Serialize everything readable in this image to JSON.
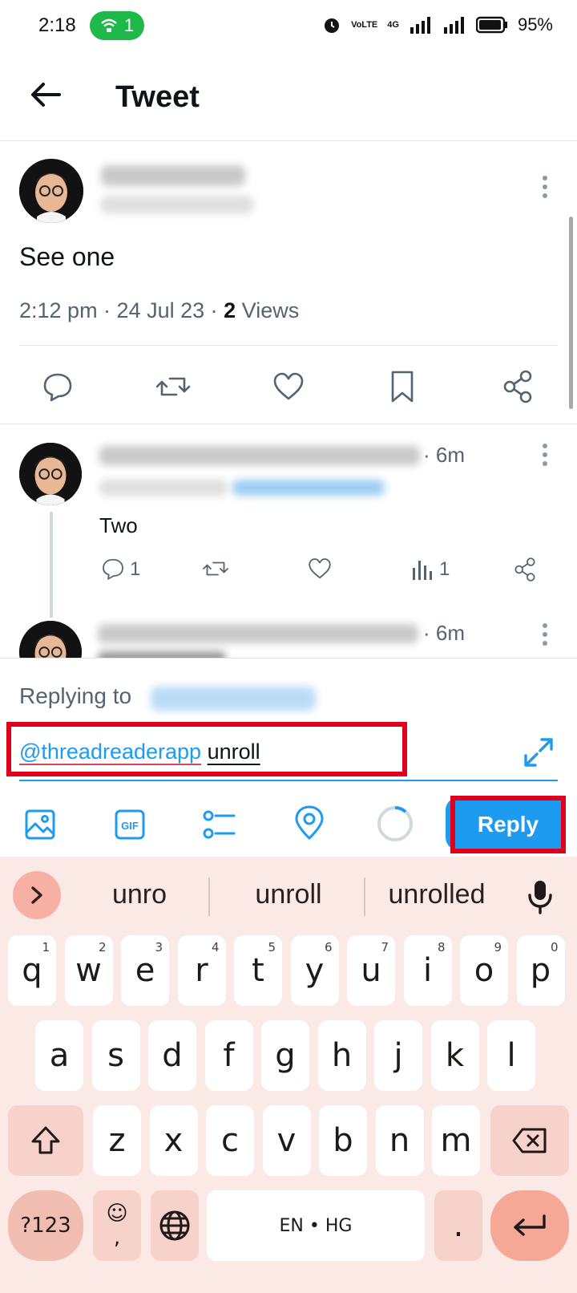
{
  "status_bar": {
    "time": "2:18",
    "hotspot_count": "1",
    "volte": "VoLTE",
    "network": "4G",
    "battery": "95%"
  },
  "header": {
    "title": "Tweet"
  },
  "main_tweet": {
    "text": "See one",
    "time": "2:12 pm · 24 Jul 23 · ",
    "views_count": "2",
    "views_label": " Views"
  },
  "replies": [
    {
      "time": "· 6m",
      "text": "Two",
      "reply_count": "1",
      "view_count": "1"
    },
    {
      "time": "· 6m"
    }
  ],
  "compose": {
    "replying_to": "Replying to",
    "mention": "@threadreaderapp",
    "text": "unroll",
    "reply_button": "Reply"
  },
  "keyboard": {
    "suggestions": [
      "unro",
      "unroll",
      "unrolled"
    ],
    "row1": [
      {
        "k": "q",
        "n": "1"
      },
      {
        "k": "w",
        "n": "2"
      },
      {
        "k": "e",
        "n": "3"
      },
      {
        "k": "r",
        "n": "4"
      },
      {
        "k": "t",
        "n": "5"
      },
      {
        "k": "y",
        "n": "6"
      },
      {
        "k": "u",
        "n": "7"
      },
      {
        "k": "i",
        "n": "8"
      },
      {
        "k": "o",
        "n": "9"
      },
      {
        "k": "p",
        "n": "0"
      }
    ],
    "row2": [
      "a",
      "s",
      "d",
      "f",
      "g",
      "h",
      "j",
      "k",
      "l"
    ],
    "row3": [
      "z",
      "x",
      "c",
      "v",
      "b",
      "n",
      "m"
    ],
    "symbols_label": "?123",
    "comma_label": ",",
    "emoji_label": "☺",
    "space_label": "EN • HG",
    "period_label": "."
  },
  "colors": {
    "accent": "#1d9bf0",
    "highlight": "#e0001b",
    "keyboard_bg": "#fbe9e6"
  }
}
